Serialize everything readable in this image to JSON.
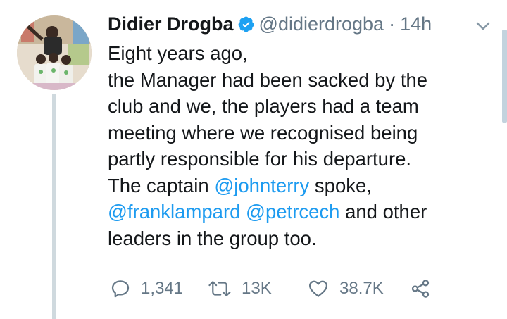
{
  "tweet": {
    "author_name": "Didier Drogba",
    "handle": "@didierdrogba",
    "separator": "·",
    "time": "14h",
    "verified": true,
    "lines": [
      [
        {
          "text": "Eight years ago,"
        }
      ],
      [
        {
          "text": "the Manager had been sacked by the"
        }
      ],
      [
        {
          "text": "club and we, the players had a team"
        }
      ],
      [
        {
          "text": "meeting where we recognised being"
        }
      ],
      [
        {
          "text": "partly responsible for his departure."
        }
      ],
      [
        {
          "text": "The captain "
        },
        {
          "text": "@johnterry",
          "mention": true
        },
        {
          "text": " spoke,"
        }
      ],
      [
        {
          "text": "@franklampard",
          "mention": true
        },
        {
          "text": " "
        },
        {
          "text": "@petrcech",
          "mention": true
        },
        {
          "text": " and other"
        }
      ],
      [
        {
          "text": "leaders in the group too."
        }
      ]
    ],
    "stats": {
      "replies": "1,341",
      "retweets": "13K",
      "likes": "38.7K"
    }
  },
  "colors": {
    "mention": "#1d9bf0",
    "verified": "#1da1f2",
    "muted": "#657786",
    "thread_line": "#cfd9de"
  },
  "icons": {
    "verified": "verified-badge-icon",
    "caret": "chevron-down-icon",
    "reply": "reply-icon",
    "retweet": "retweet-icon",
    "like": "heart-icon",
    "share": "share-icon"
  }
}
